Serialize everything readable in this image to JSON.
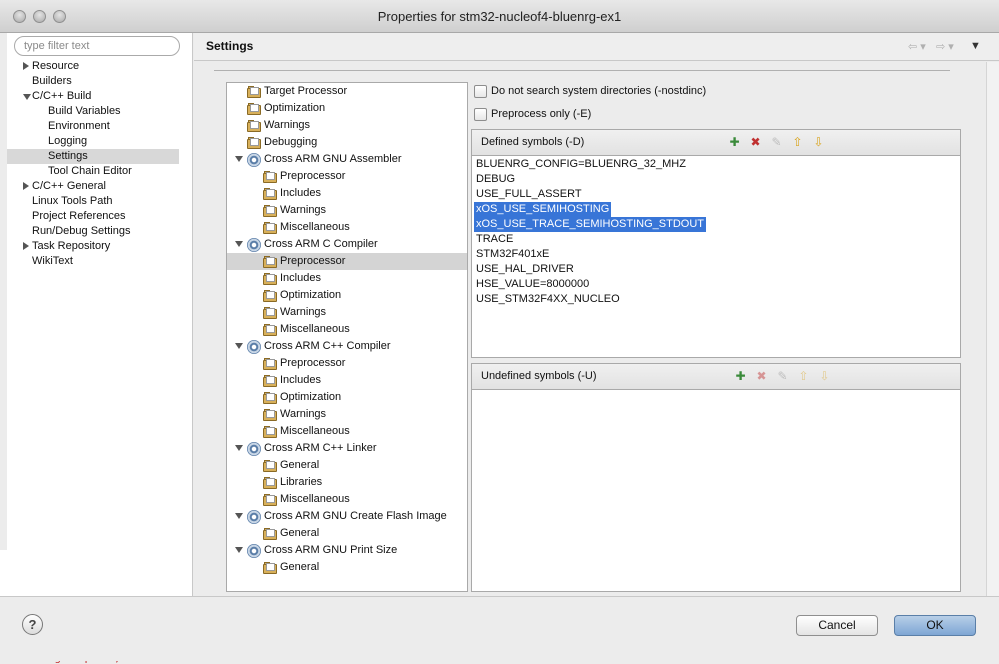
{
  "window": {
    "title": "Properties for stm32-nucleof4-bluenrg-ex1"
  },
  "filter": {
    "placeholder": "type filter text"
  },
  "sidebar": {
    "items": [
      {
        "label": "Resource",
        "expander": "right"
      },
      {
        "label": "Builders",
        "expander": ""
      },
      {
        "label": "C/C++ Build",
        "expander": "down"
      },
      {
        "label": "Build Variables",
        "expander": ""
      },
      {
        "label": "Environment",
        "expander": ""
      },
      {
        "label": "Logging",
        "expander": ""
      },
      {
        "label": "Settings",
        "expander": "",
        "selected": true
      },
      {
        "label": "Tool Chain Editor",
        "expander": ""
      },
      {
        "label": "C/C++ General",
        "expander": "right"
      },
      {
        "label": "Linux Tools Path",
        "expander": ""
      },
      {
        "label": "Project References",
        "expander": ""
      },
      {
        "label": "Run/Debug Settings",
        "expander": ""
      },
      {
        "label": "Task Repository",
        "expander": "right"
      },
      {
        "label": "WikiText",
        "expander": ""
      }
    ]
  },
  "header": {
    "title": "Settings",
    "back_icon": "back-arrow-icon",
    "forward_icon": "forward-arrow-icon",
    "menu_icon": "view-menu-icon"
  },
  "tool_tree": {
    "nodes": [
      {
        "label": "Target Processor",
        "icon": "folder-icon"
      },
      {
        "label": "Optimization",
        "icon": "folder-icon"
      },
      {
        "label": "Warnings",
        "icon": "folder-icon"
      },
      {
        "label": "Debugging",
        "icon": "folder-icon"
      },
      {
        "label": "Cross ARM GNU Assembler",
        "icon": "tool-icon"
      },
      {
        "label": "Preprocessor",
        "icon": "folder-icon"
      },
      {
        "label": "Includes",
        "icon": "folder-icon"
      },
      {
        "label": "Warnings",
        "icon": "folder-icon"
      },
      {
        "label": "Miscellaneous",
        "icon": "folder-icon"
      },
      {
        "label": "Cross ARM C Compiler",
        "icon": "tool-icon"
      },
      {
        "label": "Preprocessor",
        "icon": "folder-icon",
        "selected": true
      },
      {
        "label": "Includes",
        "icon": "folder-icon"
      },
      {
        "label": "Optimization",
        "icon": "folder-icon"
      },
      {
        "label": "Warnings",
        "icon": "folder-icon"
      },
      {
        "label": "Miscellaneous",
        "icon": "folder-icon"
      },
      {
        "label": "Cross ARM C++ Compiler",
        "icon": "tool-icon"
      },
      {
        "label": "Preprocessor",
        "icon": "folder-icon"
      },
      {
        "label": "Includes",
        "icon": "folder-icon"
      },
      {
        "label": "Optimization",
        "icon": "folder-icon"
      },
      {
        "label": "Warnings",
        "icon": "folder-icon"
      },
      {
        "label": "Miscellaneous",
        "icon": "folder-icon"
      },
      {
        "label": "Cross ARM C++ Linker",
        "icon": "tool-icon"
      },
      {
        "label": "General",
        "icon": "folder-icon"
      },
      {
        "label": "Libraries",
        "icon": "folder-icon"
      },
      {
        "label": "Miscellaneous",
        "icon": "folder-icon"
      },
      {
        "label": "Cross ARM GNU Create Flash Image",
        "icon": "tool-icon"
      },
      {
        "label": "General",
        "icon": "folder-icon"
      },
      {
        "label": "Cross ARM GNU Print Size",
        "icon": "tool-icon"
      },
      {
        "label": "General",
        "icon": "folder-icon"
      }
    ]
  },
  "options": {
    "nostdinc_label": "Do not search system directories (-nostdinc)",
    "nostdinc_checked": false,
    "preprocess_only_label": "Preprocess only (-E)",
    "preprocess_only_checked": false
  },
  "defined_symbols": {
    "label": "Defined symbols (-D)",
    "items": [
      {
        "text": "BLUENRG_CONFIG=BLUENRG_32_MHZ",
        "selected": false
      },
      {
        "text": "DEBUG",
        "selected": false
      },
      {
        "text": "USE_FULL_ASSERT",
        "selected": false
      },
      {
        "text": "xOS_USE_SEMIHOSTING",
        "selected": true
      },
      {
        "text": "xOS_USE_TRACE_SEMIHOSTING_STDOUT",
        "selected": true
      },
      {
        "text": "TRACE",
        "selected": false
      },
      {
        "text": "STM32F401xE",
        "selected": false
      },
      {
        "text": "USE_HAL_DRIVER",
        "selected": false
      },
      {
        "text": "HSE_VALUE=8000000",
        "selected": false
      },
      {
        "text": "USE_STM32F4XX_NUCLEO",
        "selected": false
      }
    ]
  },
  "undefined_symbols": {
    "label": "Undefined symbols (-U)",
    "items": []
  },
  "list_toolbar": [
    "add-icon",
    "delete-icon",
    "edit-icon",
    "move-up-icon",
    "move-down-icon"
  ],
  "footer": {
    "help_label": "?",
    "cancel_label": "Cancel",
    "ok_label": "OK"
  },
  "background": {
    "console_text": "to debug-request, current mode: Thread"
  }
}
